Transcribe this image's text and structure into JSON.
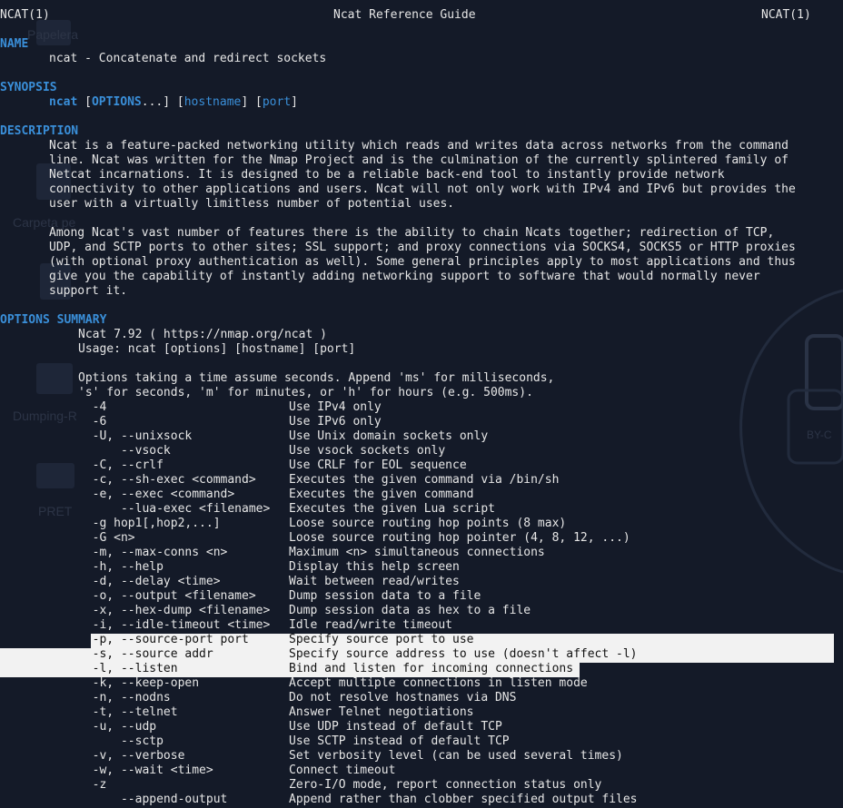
{
  "desktop": {
    "icons": [
      "Papelera",
      "Carpeta pe",
      "Dumping-R",
      "PRET"
    ],
    "wallpaper_text": "BY-C"
  },
  "header": {
    "left": "NCAT(1)",
    "center": "Ncat Reference Guide",
    "right": "NCAT(1)"
  },
  "name": {
    "heading": "NAME",
    "text": "ncat - Concatenate and redirect sockets"
  },
  "synopsis": {
    "heading": "SYNOPSIS",
    "cmd": "ncat",
    "options": "OPTIONS",
    "host": "hostname",
    "port": "port"
  },
  "description": {
    "heading": "DESCRIPTION",
    "p1": [
      "Ncat is a feature-packed networking utility which reads and writes data across networks from the command",
      "line. Ncat was written for the Nmap Project and is the culmination of the currently splintered family of",
      "Netcat incarnations. It is designed to be a reliable back-end tool to instantly provide network",
      "connectivity to other applications and users. Ncat will not only work with IPv4 and IPv6 but provides the",
      "user with a virtually limitless number of potential uses."
    ],
    "p2": [
      "Among Ncat's vast number of features there is the ability to chain Ncats together; redirection of TCP,",
      "UDP, and SCTP ports to other sites; SSL support; and proxy connections via SOCKS4, SOCKS5 or HTTP proxies",
      "(with optional proxy authentication as well). Some general principles apply to most applications and thus",
      "give you the capability of instantly adding networking support to software that would normally never",
      "support it."
    ]
  },
  "summary": {
    "heading": "OPTIONS SUMMARY",
    "version": "Ncat 7.92 ( https://nmap.org/ncat )",
    "usage": "Usage: ncat [options] [hostname] [port]",
    "note1": "Options taking a time assume seconds. Append 'ms' for milliseconds,",
    "note2": "'s' for seconds, 'm' for minutes, or 'h' for hours (e.g. 500ms).",
    "options": [
      {
        "flag": "  -4",
        "desc": "Use IPv4 only"
      },
      {
        "flag": "  -6",
        "desc": "Use IPv6 only"
      },
      {
        "flag": "  -U, --unixsock",
        "desc": "Use Unix domain sockets only"
      },
      {
        "flag": "      --vsock",
        "desc": "Use vsock sockets only"
      },
      {
        "flag": "  -C, --crlf",
        "desc": "Use CRLF for EOL sequence"
      },
      {
        "flag": "  -c, --sh-exec <command>",
        "desc": "Executes the given command via /bin/sh"
      },
      {
        "flag": "  -e, --exec <command>",
        "desc": "Executes the given command"
      },
      {
        "flag": "      --lua-exec <filename>",
        "desc": "Executes the given Lua script"
      },
      {
        "flag": "  -g hop1[,hop2,...]",
        "desc": "Loose source routing hop points (8 max)"
      },
      {
        "flag": "  -G <n>",
        "desc": "Loose source routing hop pointer (4, 8, 12, ...)"
      },
      {
        "flag": "  -m, --max-conns <n>",
        "desc": "Maximum <n> simultaneous connections"
      },
      {
        "flag": "  -h, --help",
        "desc": "Display this help screen"
      },
      {
        "flag": "  -d, --delay <time>",
        "desc": "Wait between read/writes"
      },
      {
        "flag": "  -o, --output <filename>",
        "desc": "Dump session data to a file"
      },
      {
        "flag": "  -x, --hex-dump <filename>",
        "desc": "Dump session data as hex to a file"
      },
      {
        "flag": "  -i, --idle-timeout <time>",
        "desc": "Idle read/write timeout"
      },
      {
        "flag": "  -p, --source-port port",
        "desc": "Specify source port to use"
      },
      {
        "flag": "  -s, --source addr",
        "desc": "Specify source address to use (doesn't affect -l)"
      },
      {
        "flag": "  -l, --listen",
        "desc": "Bind and listen for incoming connections"
      },
      {
        "flag": "  -k, --keep-open",
        "desc": "Accept multiple connections in listen mode"
      },
      {
        "flag": "  -n, --nodns",
        "desc": "Do not resolve hostnames via DNS"
      },
      {
        "flag": "  -t, --telnet",
        "desc": "Answer Telnet negotiations"
      },
      {
        "flag": "  -u, --udp",
        "desc": "Use UDP instead of default TCP"
      },
      {
        "flag": "      --sctp",
        "desc": "Use SCTP instead of default TCP"
      },
      {
        "flag": "  -v, --verbose",
        "desc": "Set verbosity level (can be used several times)"
      },
      {
        "flag": "  -w, --wait <time>",
        "desc": "Connect timeout"
      },
      {
        "flag": "  -z",
        "desc": "Zero-I/O mode, report connection status only"
      },
      {
        "flag": "      --append-output",
        "desc": "Append rather than clobber specified output files"
      }
    ]
  },
  "colors": {
    "heading": "#3a8fd9",
    "background": "#141a28",
    "text": "#e6e6e6",
    "selection": "#f2f2f2"
  }
}
